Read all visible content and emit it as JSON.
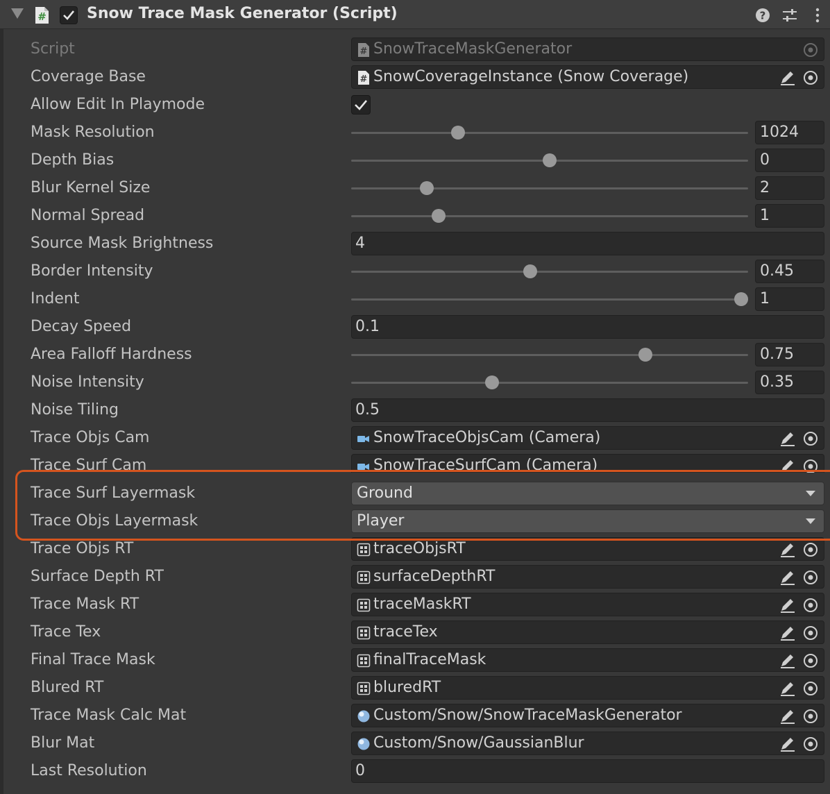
{
  "header": {
    "title": "Snow Trace Mask Generator (Script)",
    "enabled": true,
    "icons": [
      "foldout-arrow-icon",
      "script-hash-icon",
      "help-icon",
      "preset-sliders-icon",
      "kebab-menu-icon"
    ]
  },
  "colors": {
    "background": "#383838",
    "field": "#2a2a2a",
    "dropdown": "#515151",
    "highlight": "#d5541e",
    "camera_icon": "#7db8e8"
  },
  "fields": {
    "script": {
      "label": "Script",
      "value": "SnowTraceMaskGenerator"
    },
    "coverage_base": {
      "label": "Coverage Base",
      "value": "SnowCoverageInstance (Snow Coverage)"
    },
    "allow_edit": {
      "label": "Allow Edit In Playmode",
      "checked": true
    },
    "mask_resolution": {
      "label": "Mask Resolution",
      "value": "1024",
      "slider_fraction": 0.26
    },
    "depth_bias": {
      "label": "Depth Bias",
      "value": "0",
      "slider_fraction": 0.5
    },
    "blur_kernel_size": {
      "label": "Blur Kernel Size",
      "value": "2",
      "slider_fraction": 0.18
    },
    "normal_spread": {
      "label": "Normal Spread",
      "value": "1",
      "slider_fraction": 0.21
    },
    "source_mask_brightness": {
      "label": "Source Mask Brightness",
      "value": "4"
    },
    "border_intensity": {
      "label": "Border Intensity",
      "value": "0.45",
      "slider_fraction": 0.45
    },
    "indent": {
      "label": "Indent",
      "value": "1",
      "slider_fraction": 1.0
    },
    "decay_speed": {
      "label": "Decay Speed",
      "value": "0.1"
    },
    "area_falloff_hardness": {
      "label": "Area Falloff Hardness",
      "value": "0.75",
      "slider_fraction": 0.75
    },
    "noise_intensity": {
      "label": "Noise Intensity",
      "value": "0.35",
      "slider_fraction": 0.35
    },
    "noise_tiling": {
      "label": "Noise Tiling",
      "value": "0.5"
    },
    "trace_objs_cam": {
      "label": "Trace Objs Cam",
      "value": "SnowTraceObjsCam (Camera)"
    },
    "trace_surf_cam": {
      "label": "Trace Surf Cam",
      "value": "SnowTraceSurfCam (Camera)"
    },
    "trace_surf_layermask": {
      "label": "Trace Surf Layermask",
      "value": "Ground"
    },
    "trace_objs_layermask": {
      "label": "Trace Objs Layermask",
      "value": "Player"
    },
    "trace_objs_rt": {
      "label": "Trace Objs RT",
      "value": "traceObjsRT"
    },
    "surface_depth_rt": {
      "label": "Surface Depth RT",
      "value": "surfaceDepthRT"
    },
    "trace_mask_rt": {
      "label": "Trace Mask RT",
      "value": "traceMaskRT"
    },
    "trace_tex": {
      "label": "Trace Tex",
      "value": "traceTex"
    },
    "final_trace_mask": {
      "label": "Final Trace Mask",
      "value": "finalTraceMask"
    },
    "blured_rt": {
      "label": "Blured RT",
      "value": "bluredRT"
    },
    "trace_mask_calc_mat": {
      "label": "Trace Mask Calc Mat",
      "value": "Custom/Snow/SnowTraceMaskGenerator"
    },
    "blur_mat": {
      "label": "Blur Mat",
      "value": "Custom/Snow/GaussianBlur"
    },
    "last_resolution": {
      "label": "Last Resolution",
      "value": "0"
    }
  }
}
